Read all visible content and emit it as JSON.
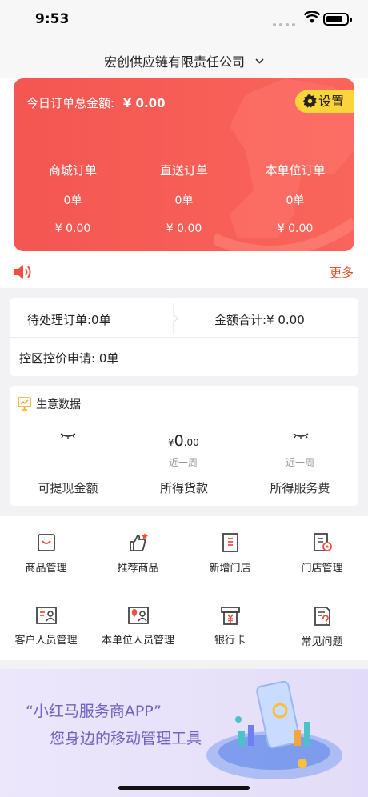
{
  "status_bar": {
    "time": "9:53"
  },
  "header": {
    "company": "宏创供应链有限责任公司"
  },
  "summary": {
    "total_label": "今日订单总金额:",
    "total_value": "¥ 0.00",
    "settings_label": "设置",
    "columns": [
      {
        "label": "商城订单",
        "count": "0单",
        "amount": "¥ 0.00"
      },
      {
        "label": "直送订单",
        "count": "0单",
        "amount": "¥ 0.00"
      },
      {
        "label": "本单位订单",
        "count": "0单",
        "amount": "¥ 0.00"
      }
    ]
  },
  "notice": {
    "more_label": "更多"
  },
  "orders": {
    "pending": "待处理订单:0单",
    "sum": "金额合计:¥ 0.00",
    "control": "控区控价申请: 0单"
  },
  "business": {
    "title": "生意数据",
    "goods_currency": "¥",
    "goods_int": "0",
    "goods_dec": ".00",
    "week_label_1": "近一周",
    "week_label_2": "近一周",
    "withdrawable_label": "可提现金额",
    "goods_label": "所得货款",
    "service_label": "所得服务费"
  },
  "grid": [
    {
      "label": "商品管理",
      "icon": "bag-icon"
    },
    {
      "label": "推荐商品",
      "icon": "thumb-up-icon"
    },
    {
      "label": "新增门店",
      "icon": "store-add-icon"
    },
    {
      "label": "门店管理",
      "icon": "store-manage-icon"
    },
    {
      "label": "客户人员管理",
      "icon": "contact-card-icon"
    },
    {
      "label": "本单位人员管理",
      "icon": "location-card-icon"
    },
    {
      "label": "银行卡",
      "icon": "yen-card-icon"
    },
    {
      "label": "常见问题",
      "icon": "question-doc-icon"
    }
  ],
  "banner": {
    "line1": "“小红马服务商APP”",
    "line2": "您身边的移动管理工具"
  },
  "colors": {
    "card_red": "#f45651",
    "settings_yellow": "#fbd43a",
    "accent_orange": "#e2522c",
    "banner_purple": "#7163c2"
  }
}
